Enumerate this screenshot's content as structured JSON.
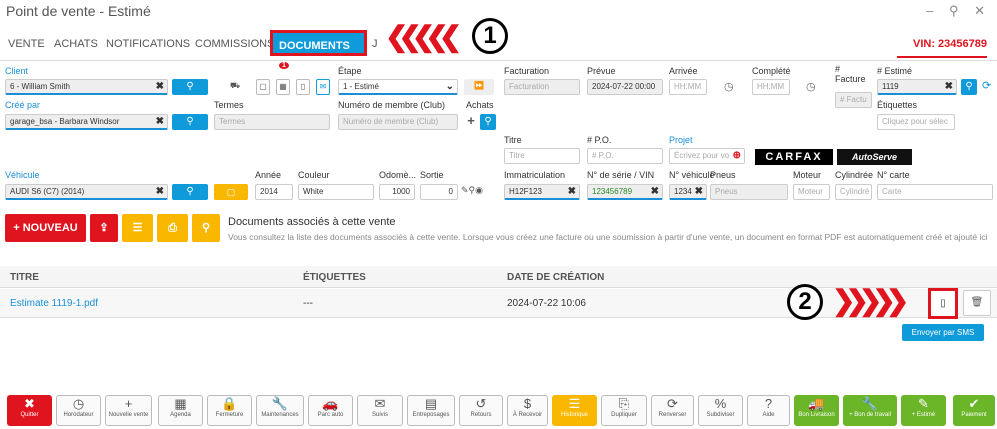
{
  "window": {
    "title": "Point de vente - Estimé",
    "controls": "–  ⚲  ✕"
  },
  "tabs": [
    "VENTE",
    "ACHATS",
    "NOTIFICATIONS",
    "COMMISSIONS",
    "DOCUMENTS",
    "J"
  ],
  "tab_badge": "1",
  "vin_tab": "VIN: 23456789",
  "form": {
    "client_label": "Client",
    "client_value": "6 - William Smith",
    "etape_label": "Étape",
    "etape_value": "1 - Estimé",
    "facturation_label": "Facturation",
    "facturation_ph": "Facturation",
    "prevue_label": "Prévue",
    "prevue_value": "2024-07-22 00:00",
    "arrivee_label": "Arrivée",
    "arrivee_ph": "HH:MM",
    "complete_label": "Complété",
    "complete_ph": "HH:MM",
    "facture_label": "# Facture",
    "facture_ph": "# Factu",
    "estime_label": "# Estimé",
    "estime_value": "1119",
    "cree_label": "Créé par",
    "cree_value": "garage_bsa - Barbara Windsor",
    "termes_label": "Termes",
    "termes_ph": "Termes",
    "membre_label": "Numéro de membre (Club)",
    "membre_ph": "Numéro de membre (Club)",
    "achats_label": "Achats",
    "etiquettes_label": "Étiquettes",
    "etiquettes_ph": "Cliquez pour sélec",
    "titre_label": "Titre",
    "titre_ph": "Titre",
    "po_label": "# P.O.",
    "po_ph": "# P.O.",
    "projet_label": "Projet",
    "projet_ph": "Écrivez pour vo",
    "carfax": "CARFAX",
    "autoserve": "AutoServe",
    "vehicule_label": "Véhicule",
    "vehicule_value": "AUDI S6 (C7) (2014)",
    "annee_label": "Année",
    "annee_value": "2014",
    "couleur_label": "Couleur",
    "couleur_value": "White",
    "odometre_label": "Odomè...",
    "odometre_value": "1000",
    "sortie_label": "Sortie",
    "sortie_value": "0",
    "immat_label": "Immatriculation",
    "immat_value": "H12F123",
    "serie_label": "N° de série / VIN",
    "serie_value": "123456789",
    "nveh_label": "N° véhicule",
    "nveh_value": "1234",
    "pneus_label": "Pneus",
    "pneus_ph": "Pneus",
    "moteur_label": "Moteur",
    "moteur_ph": "Moteur",
    "cyl_label": "Cylindrée",
    "cyl_ph": "Cylindré",
    "carte_label": "N° carte",
    "carte_ph": "Carte"
  },
  "actions": {
    "nouveau": "+ NOUVEAU"
  },
  "docs": {
    "heading": "Documents associés à cette vente",
    "desc": "Vous consultez la liste des documents associés à cette vente. Lorsque vous créez une facture ou une soumission à partir d'une vente, un document en format PDF est automatiquement créé et ajouté ici"
  },
  "table": {
    "headers": [
      "TITRE",
      "ÉTIQUETTES",
      "DATE DE CRÉATION"
    ],
    "rows": [
      {
        "titre": "Estimate 1119-1.pdf",
        "etiquettes": "---",
        "date": "2024-07-22 10:06"
      }
    ]
  },
  "tooltip": "Envoyer par SMS",
  "annotations": [
    "1",
    "2"
  ],
  "footer": [
    {
      "icon": "✖",
      "label": "Quitter"
    },
    {
      "icon": "◷",
      "label": "Horodateur"
    },
    {
      "icon": "+",
      "label": "Nouvelle vente"
    },
    {
      "icon": "▦",
      "label": "Agenda"
    },
    {
      "icon": "🔒",
      "label": "Fermeture"
    },
    {
      "icon": "🔧",
      "label": "Maintenances"
    },
    {
      "icon": "🚗",
      "label": "Parc auto"
    },
    {
      "icon": "✉",
      "label": "Suivis"
    },
    {
      "icon": "▤",
      "label": "Entreposages"
    },
    {
      "icon": "↺",
      "label": "Retours"
    },
    {
      "icon": "$",
      "label": "À Recevoir"
    },
    {
      "icon": "☰",
      "label": "Historique"
    },
    {
      "icon": "⎘",
      "label": "Dupliquer"
    },
    {
      "icon": "⟳",
      "label": "Renverser"
    },
    {
      "icon": "%",
      "label": "Subdiviser"
    },
    {
      "icon": "?",
      "label": "Aide"
    },
    {
      "icon": "🚚",
      "label": "Bon Livraison"
    },
    {
      "icon": "🔧",
      "label": "+ Bon de travail"
    },
    {
      "icon": "✎",
      "label": "+ Estimé"
    },
    {
      "icon": "✔",
      "label": "Paiement"
    }
  ]
}
